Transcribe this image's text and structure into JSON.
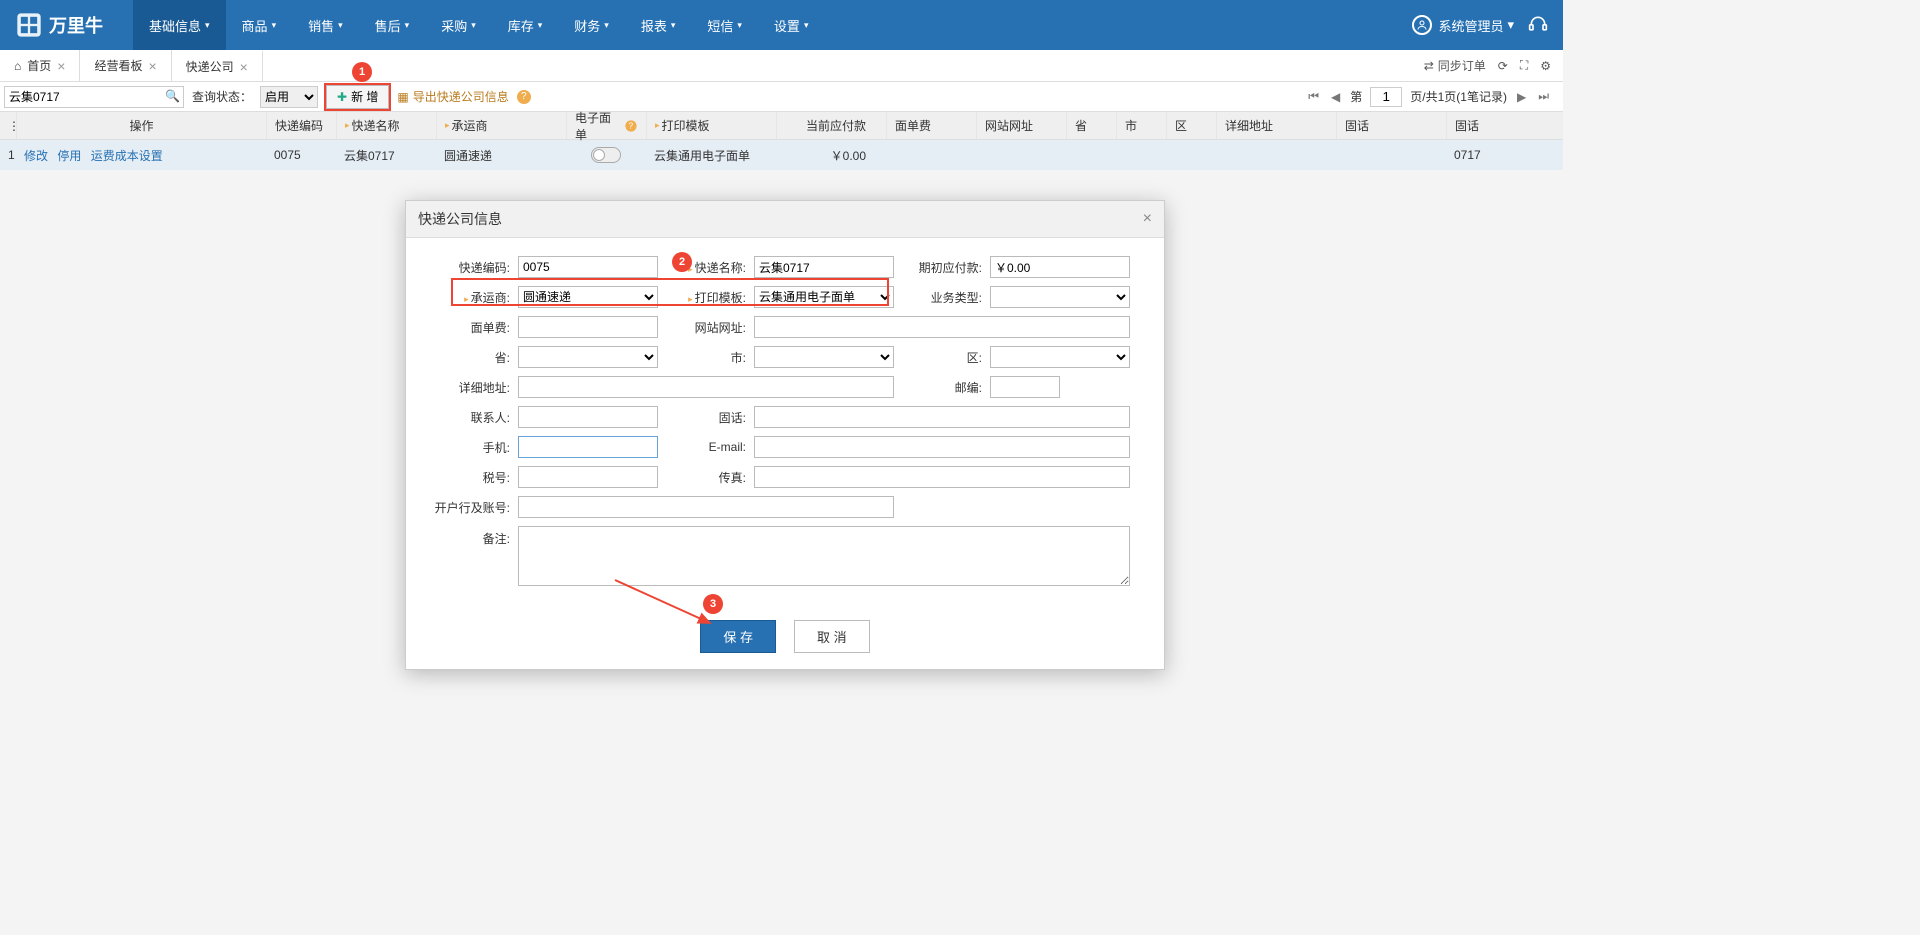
{
  "brand": "万里牛",
  "nav": [
    "基础信息",
    "商品",
    "销售",
    "售后",
    "采购",
    "库存",
    "财务",
    "报表",
    "短信",
    "设置"
  ],
  "nav_active_index": 0,
  "header_right": {
    "user": "系统管理员"
  },
  "tabs": {
    "home": "首页",
    "items": [
      "经营看板",
      "快递公司"
    ],
    "active": "快递公司",
    "sync": "同步订单"
  },
  "toolbar": {
    "search_value": "云集0717",
    "status_label": "查询状态：",
    "status_value": "启用",
    "new_label": "新 增",
    "export_label": "导出快递公司信息"
  },
  "pagination": {
    "prefix": "第",
    "page": "1",
    "total_text": "页/共1页(1笔记录)"
  },
  "grid": {
    "headers": {
      "op": "操作",
      "code": "快递编码",
      "name": "快递名称",
      "carrier": "承运商",
      "esheet": "电子面单",
      "tpl": "打印模板",
      "pay": "当前应付款",
      "fee": "面单费",
      "url": "网站网址",
      "prov": "省",
      "city": "市",
      "dist": "区",
      "addr": "详细地址",
      "tel": "固话",
      "tel2": "固话"
    },
    "row": {
      "idx": "1",
      "actions": {
        "edit": "修改",
        "disable": "停用",
        "freight": "运费成本设置"
      },
      "code": "0075",
      "name": "云集0717",
      "carrier": "圆通速递",
      "tpl": "云集通用电子面单",
      "pay": "￥0.00",
      "tel2": "0717"
    }
  },
  "modal": {
    "title": "快递公司信息",
    "labels": {
      "code": "快递编码:",
      "name": "快递名称:",
      "init_pay": "期初应付款:",
      "carrier": "承运商:",
      "tpl": "打印模板:",
      "biz_type": "业务类型:",
      "fee": "面单费:",
      "url": "网站网址:",
      "prov": "省:",
      "city": "市:",
      "dist": "区:",
      "addr": "详细地址:",
      "zip": "邮编:",
      "contact": "联系人:",
      "tel": "固话:",
      "mobile": "手机:",
      "email": "E-mail:",
      "tax": "税号:",
      "fax": "传真:",
      "bank": "开户行及账号:",
      "remark": "备注:"
    },
    "values": {
      "code": "0075",
      "name": "云集0717",
      "init_pay": "￥0.00",
      "carrier": "圆通速递",
      "tpl": "云集通用电子面单"
    },
    "buttons": {
      "save": "保 存",
      "cancel": "取 消"
    }
  },
  "anno": {
    "b1": "1",
    "b2": "2",
    "b3": "3"
  }
}
